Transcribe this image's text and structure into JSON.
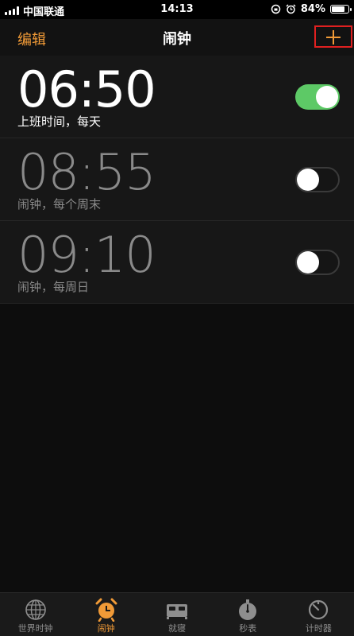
{
  "status_bar": {
    "carrier": "中国联通",
    "time": "14:13",
    "battery_percent_text": "84%",
    "battery_level": 0.84,
    "icons": [
      "signal-icon",
      "rotation-lock-icon",
      "alarm-clock-icon",
      "battery-icon"
    ]
  },
  "nav": {
    "edit_label": "编辑",
    "title": "闹钟",
    "add_icon": "plus-icon"
  },
  "alarms": [
    {
      "time": "06:50",
      "label": "上班时间，每天",
      "enabled": true
    },
    {
      "time": "08:55",
      "label": "闹钟，每个周末",
      "enabled": false
    },
    {
      "time": "09:10",
      "label": "闹钟，每周日",
      "enabled": false
    }
  ],
  "tabs": [
    {
      "label": "世界时钟",
      "icon": "globe-icon",
      "active": false
    },
    {
      "label": "闹钟",
      "icon": "alarm-clock-icon",
      "active": true
    },
    {
      "label": "就寝",
      "icon": "bed-icon",
      "active": false
    },
    {
      "label": "秒表",
      "icon": "stopwatch-icon",
      "active": false
    },
    {
      "label": "计时器",
      "icon": "timer-icon",
      "active": false
    }
  ],
  "colors": {
    "accent": "#f09a37",
    "toggle_on": "#5dc966",
    "highlight_box": "#e02020",
    "background": "#0d0d0d"
  }
}
